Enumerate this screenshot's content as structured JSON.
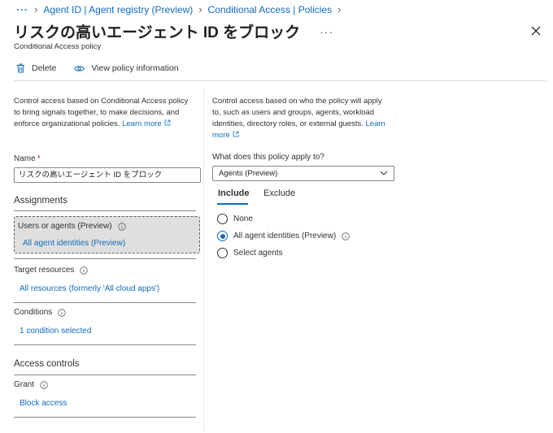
{
  "breadcrumb": {
    "items": [
      "Agent ID | Agent registry (Preview)",
      "Conditional Access | Policies"
    ]
  },
  "header": {
    "title": "リスクの高いエージェント ID をブロック",
    "more": "···",
    "subtitle": "Conditional Access policy"
  },
  "toolbar": {
    "delete_label": "Delete",
    "view_label": "View policy information"
  },
  "left": {
    "description": "Control access based on Conditional Access policy to bring signals together, to make decisions, and enforce organizational policies.",
    "learn_more": "Learn more",
    "name_label": "Name",
    "required_mark": "*",
    "name_value": "リスクの高いエージェント ID をブロック",
    "assignments_heading": "Assignments",
    "users_title": "Users or agents (Preview)",
    "users_value": "All agent identities (Preview)",
    "target_title": "Target resources",
    "target_value": "All resources (formerly 'All cloud apps')",
    "conditions_title": "Conditions",
    "conditions_value": "1 condition selected",
    "access_heading": "Access controls",
    "grant_title": "Grant",
    "grant_value": "Block access"
  },
  "right": {
    "description": "Control access based on who the policy will apply to, such as users and groups, agents, workload identities, directory roles, or external guests.",
    "learn_more": "Learn more",
    "apply_label": "What does this policy apply to?",
    "apply_value": "Agents (Preview)",
    "tabs": [
      {
        "label": "Include",
        "selected": true
      },
      {
        "label": "Exclude",
        "selected": false
      }
    ],
    "options": [
      {
        "label": "None",
        "selected": false
      },
      {
        "label": "All agent identities (Preview)",
        "selected": true
      },
      {
        "label": "Select agents",
        "selected": false
      }
    ]
  },
  "colors": {
    "accent": "#0f6cbd",
    "required": "#a4262c",
    "selected_box": "#e1dfdd"
  }
}
